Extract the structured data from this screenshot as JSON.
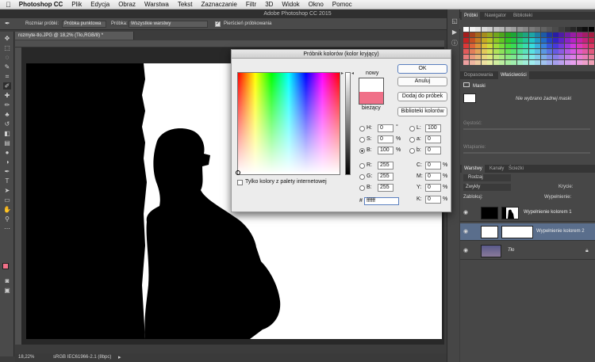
{
  "menubar": {
    "apple": "",
    "app": "Photoshop CC",
    "items": [
      "Plik",
      "Edycja",
      "Obraz",
      "Warstwa",
      "Tekst",
      "Zaznaczanie",
      "Filtr",
      "3D",
      "Widok",
      "Okno",
      "Pomoc"
    ]
  },
  "window_title": "Adobe Photoshop CC 2015",
  "options": {
    "sample_size_label": "Rozmiar próbki:",
    "sample_size_value": "Próbka punktowa",
    "sample_label": "Próbka:",
    "sample_value": "Wszystkie warstwy",
    "ring_label": "Pierścień próbkowania",
    "ring_checked": true
  },
  "document": {
    "tab": "rozmyte-tlo.JPG @ 18,2% (Tło,RGB/8) *"
  },
  "status": {
    "zoom": "18,22%",
    "profile": "sRGB IEC61966-2.1 (8bpc)"
  },
  "dialog": {
    "title": "Próbnik kolorów (kolor kryjący)",
    "buttons": {
      "ok": "OK",
      "cancel": "Anuluj",
      "add": "Dodaj do próbek",
      "libs": "Biblioteki kolorów"
    },
    "new_label": "nowy",
    "current_label": "bieżący",
    "new_color": "#ffffff",
    "current_color": "#f07088",
    "web_only_label": "Tylko kolory z palety internetowej",
    "hsb": {
      "h_label": "H:",
      "h": "0",
      "h_unit": "°",
      "s_label": "S:",
      "s": "0",
      "s_unit": "%",
      "b_label": "B:",
      "b": "100",
      "b_unit": "%"
    },
    "lab": {
      "l_label": "L:",
      "l": "100",
      "a_label": "a:",
      "a": "0",
      "b_label": "b:",
      "b": "0"
    },
    "rgb": {
      "r_label": "R:",
      "r": "255",
      "g_label": "G:",
      "g": "255",
      "b_label": "B:",
      "b": "255"
    },
    "cmyk": {
      "c_label": "C:",
      "c": "0",
      "m_label": "M:",
      "m": "0",
      "y_label": "Y:",
      "y": "0",
      "k_label": "K:",
      "k": "0",
      "unit": "%"
    },
    "hex_label": "#",
    "hex": "ffffff"
  },
  "panels": {
    "swatch_tabs": [
      "Próbki",
      "Nawigator",
      "Biblioteki"
    ],
    "props_tabs": [
      "Dopasowania",
      "Właściwości"
    ],
    "props_title": "Maski",
    "props_text": "Nie wybrano żadnej maski",
    "density_label": "Gęstość:",
    "feather_label": "Wtapianie:",
    "layers_tabs": [
      "Warstwy",
      "Kanały",
      "Ścieżki"
    ],
    "kind_label": "Rodzaj",
    "blend_mode": "Zwykły",
    "opacity_label": "Krycie:",
    "lock_label": "Zablokuj:",
    "fill_label": "Wypełnienie:",
    "layers": [
      {
        "name": "Wypełnienie kolorem 1"
      },
      {
        "name": "Wypełnienie kolorem 2"
      },
      {
        "name": "Tło"
      }
    ]
  },
  "colors": {
    "foreground": "#f07088",
    "background": "#ffffff",
    "accent": "#5a7fbf"
  }
}
